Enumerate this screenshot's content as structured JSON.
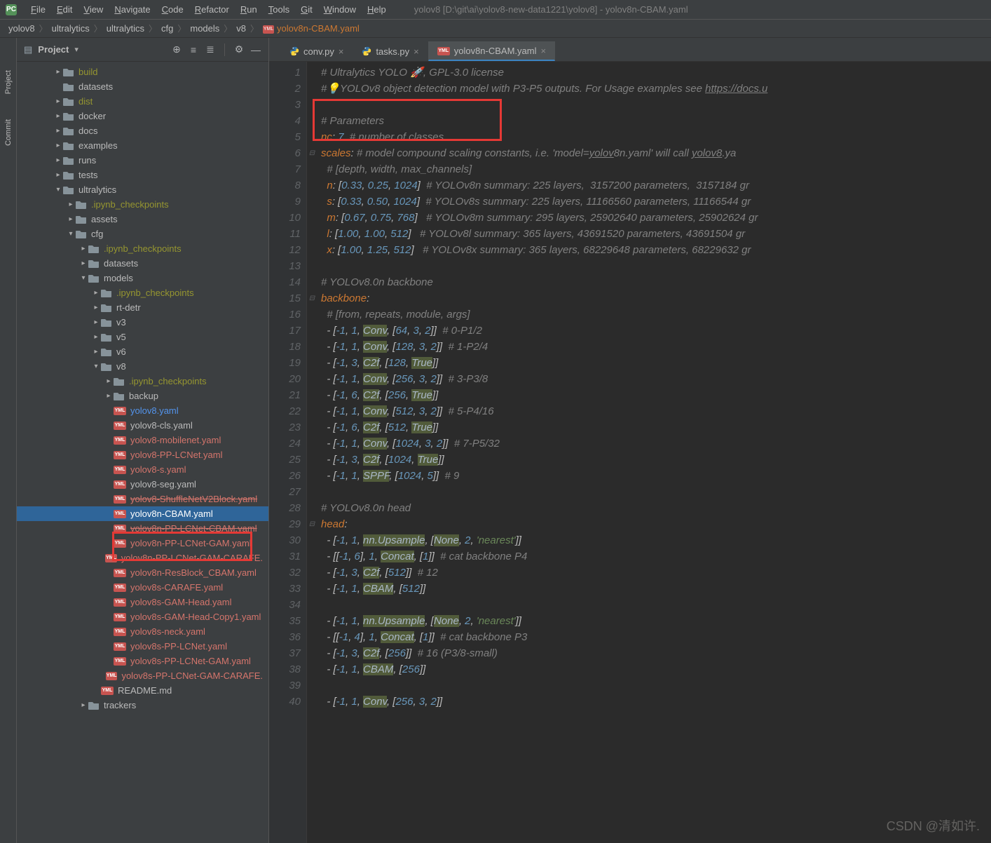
{
  "menubar": {
    "items": [
      "File",
      "Edit",
      "View",
      "Navigate",
      "Code",
      "Refactor",
      "Run",
      "Tools",
      "Git",
      "Window",
      "Help"
    ],
    "title": "yolov8 [D:\\git\\ai\\yolov8-new-data1221\\yolov8] - yolov8n-CBAM.yaml"
  },
  "breadcrumb": [
    "yolov8",
    "ultralytics",
    "ultralytics",
    "cfg",
    "models",
    "v8",
    "yolov8n-CBAM.yaml"
  ],
  "left_gutter": {
    "project_label": "Project",
    "commit_label": "Commit"
  },
  "project_panel": {
    "title": "Project"
  },
  "tree": [
    {
      "d": 2,
      "t": "folder",
      "chev": ">",
      "name": "build",
      "cls": "olive"
    },
    {
      "d": 2,
      "t": "folder",
      "chev": "",
      "name": "datasets",
      "cls": ""
    },
    {
      "d": 2,
      "t": "folder",
      "chev": ">",
      "name": "dist",
      "cls": "olive"
    },
    {
      "d": 2,
      "t": "folder",
      "chev": ">",
      "name": "docker",
      "cls": ""
    },
    {
      "d": 2,
      "t": "folder",
      "chev": ">",
      "name": "docs",
      "cls": ""
    },
    {
      "d": 2,
      "t": "folder",
      "chev": ">",
      "name": "examples",
      "cls": ""
    },
    {
      "d": 2,
      "t": "folder",
      "chev": ">",
      "name": "runs",
      "cls": ""
    },
    {
      "d": 2,
      "t": "folder",
      "chev": ">",
      "name": "tests",
      "cls": ""
    },
    {
      "d": 2,
      "t": "folder",
      "chev": "v",
      "name": "ultralytics",
      "cls": ""
    },
    {
      "d": 3,
      "t": "folder",
      "chev": ">",
      "name": ".ipynb_checkpoints",
      "cls": "olive"
    },
    {
      "d": 3,
      "t": "folder",
      "chev": ">",
      "name": "assets",
      "cls": ""
    },
    {
      "d": 3,
      "t": "folder",
      "chev": "v",
      "name": "cfg",
      "cls": ""
    },
    {
      "d": 4,
      "t": "folder",
      "chev": ">",
      "name": ".ipynb_checkpoints",
      "cls": "olive"
    },
    {
      "d": 4,
      "t": "folder",
      "chev": ">",
      "name": "datasets",
      "cls": ""
    },
    {
      "d": 4,
      "t": "folder",
      "chev": "v",
      "name": "models",
      "cls": ""
    },
    {
      "d": 5,
      "t": "folder",
      "chev": ">",
      "name": ".ipynb_checkpoints",
      "cls": "olive"
    },
    {
      "d": 5,
      "t": "folder",
      "chev": ">",
      "name": "rt-detr",
      "cls": ""
    },
    {
      "d": 5,
      "t": "folder",
      "chev": ">",
      "name": "v3",
      "cls": ""
    },
    {
      "d": 5,
      "t": "folder",
      "chev": ">",
      "name": "v5",
      "cls": ""
    },
    {
      "d": 5,
      "t": "folder",
      "chev": ">",
      "name": "v6",
      "cls": ""
    },
    {
      "d": 5,
      "t": "folder",
      "chev": "v",
      "name": "v8",
      "cls": ""
    },
    {
      "d": 6,
      "t": "folder",
      "chev": ">",
      "name": ".ipynb_checkpoints",
      "cls": "olive"
    },
    {
      "d": 6,
      "t": "folder",
      "chev": ">",
      "name": "backup",
      "cls": ""
    },
    {
      "d": 6,
      "t": "yaml",
      "chev": "",
      "name": "yolov8.yaml",
      "cls": "blue"
    },
    {
      "d": 6,
      "t": "yaml",
      "chev": "",
      "name": "yolov8-cls.yaml",
      "cls": ""
    },
    {
      "d": 6,
      "t": "yaml",
      "chev": "",
      "name": "yolov8-mobilenet.yaml",
      "cls": "red"
    },
    {
      "d": 6,
      "t": "yaml",
      "chev": "",
      "name": "yolov8-PP-LCNet.yaml",
      "cls": "red"
    },
    {
      "d": 6,
      "t": "yaml",
      "chev": "",
      "name": "yolov8-s.yaml",
      "cls": "red"
    },
    {
      "d": 6,
      "t": "yaml",
      "chev": "",
      "name": "yolov8-seg.yaml",
      "cls": ""
    },
    {
      "d": 6,
      "t": "yaml",
      "chev": "",
      "name": "yolov8-ShuffleNetV2Block.yaml",
      "cls": "red struck"
    },
    {
      "d": 6,
      "t": "yaml",
      "chev": "",
      "name": "yolov8n-CBAM.yaml",
      "cls": "red",
      "sel": true
    },
    {
      "d": 6,
      "t": "yaml",
      "chev": "",
      "name": "yolov8n-PP-LCNet-CBAM.yaml",
      "cls": "red struck"
    },
    {
      "d": 6,
      "t": "yaml",
      "chev": "",
      "name": "yolov8n-PP-LCNet-GAM.yaml",
      "cls": "red"
    },
    {
      "d": 6,
      "t": "yaml",
      "chev": "",
      "name": "yolov8n-PP-LCNet-GAM-CARAFE.",
      "cls": "red"
    },
    {
      "d": 6,
      "t": "yaml",
      "chev": "",
      "name": "yolov8n-ResBlock_CBAM.yaml",
      "cls": "red"
    },
    {
      "d": 6,
      "t": "yaml",
      "chev": "",
      "name": "yolov8s-CARAFE.yaml",
      "cls": "red"
    },
    {
      "d": 6,
      "t": "yaml",
      "chev": "",
      "name": "yolov8s-GAM-Head.yaml",
      "cls": "red"
    },
    {
      "d": 6,
      "t": "yaml",
      "chev": "",
      "name": "yolov8s-GAM-Head-Copy1.yaml",
      "cls": "red"
    },
    {
      "d": 6,
      "t": "yaml",
      "chev": "",
      "name": "yolov8s-neck.yaml",
      "cls": "red"
    },
    {
      "d": 6,
      "t": "yaml",
      "chev": "",
      "name": "yolov8s-PP-LCNet.yaml",
      "cls": "red"
    },
    {
      "d": 6,
      "t": "yaml",
      "chev": "",
      "name": "yolov8s-PP-LCNet-GAM.yaml",
      "cls": "red"
    },
    {
      "d": 6,
      "t": "yaml",
      "chev": "",
      "name": "yolov8s-PP-LCNet-GAM-CARAFE.",
      "cls": "red"
    },
    {
      "d": 5,
      "t": "yaml",
      "chev": "",
      "name": "README.md",
      "cls": ""
    },
    {
      "d": 4,
      "t": "folder",
      "chev": ">",
      "name": "trackers",
      "cls": ""
    }
  ],
  "tabs": [
    {
      "name": "conv.py",
      "icon": "py",
      "active": false
    },
    {
      "name": "tasks.py",
      "icon": "py",
      "active": false
    },
    {
      "name": "yolov8n-CBAM.yaml",
      "icon": "yaml",
      "active": true
    }
  ],
  "code_lines": [
    {
      "n": 1,
      "html": "<span class='c-comment'># Ultralytics YOLO 🚀, GPL-3.0 license</span>"
    },
    {
      "n": 2,
      "html": "<span class='c-comment'>#💡YOLOv8 object detection model with P3-P5 outputs. For Usage examples see <u>https://docs.u</u></span>"
    },
    {
      "n": 3,
      "html": ""
    },
    {
      "n": 4,
      "html": "<span class='c-comment'># Parameters</span>"
    },
    {
      "n": 5,
      "html": "<span class='c-key'>nc</span>: <span class='c-num'>7</span>  <span class='c-comment'># number of classes</span>"
    },
    {
      "n": 6,
      "html": "<span class='c-key'>scales</span>: <span class='c-comment'># model compound scaling constants, i.e. 'model=<u>yolov</u>8n.yaml' will call <u>yolov8</u>.ya</span>"
    },
    {
      "n": 7,
      "html": "  <span class='c-comment'># [depth, width, max_channels]</span>"
    },
    {
      "n": 8,
      "html": "  <span class='c-key'>n</span>: [<span class='c-num'>0.33</span>, <span class='c-num'>0.25</span>, <span class='c-num'>1024</span>]  <span class='c-comment'># YOLOv8n summary: 225 layers,  3157200 parameters,  3157184 gr</span>"
    },
    {
      "n": 9,
      "html": "  <span class='c-key'>s</span>: [<span class='c-num'>0.33</span>, <span class='c-num'>0.50</span>, <span class='c-num'>1024</span>]  <span class='c-comment'># YOLOv8s summary: 225 layers, 11166560 parameters, 11166544 gr</span>"
    },
    {
      "n": 10,
      "html": "  <span class='c-key'>m</span>: [<span class='c-num'>0.67</span>, <span class='c-num'>0.75</span>, <span class='c-num'>768</span>]   <span class='c-comment'># YOLOv8m summary: 295 layers, 25902640 parameters, 25902624 gr</span>"
    },
    {
      "n": 11,
      "html": "  <span class='c-key'>l</span>: [<span class='c-num'>1.00</span>, <span class='c-num'>1.00</span>, <span class='c-num'>512</span>]   <span class='c-comment'># YOLOv8l summary: 365 layers, 43691520 parameters, 43691504 gr</span>"
    },
    {
      "n": 12,
      "html": "  <span class='c-key'>x</span>: [<span class='c-num'>1.00</span>, <span class='c-num'>1.25</span>, <span class='c-num'>512</span>]   <span class='c-comment'># YOLOv8x summary: 365 layers, 68229648 parameters, 68229632 gr</span>"
    },
    {
      "n": 13,
      "html": ""
    },
    {
      "n": 14,
      "html": "<span class='c-comment'># YOLOv8.0n backbone</span>"
    },
    {
      "n": 15,
      "html": "<span class='c-key'>backbone</span>:"
    },
    {
      "n": 16,
      "html": "  <span class='c-comment'># [from, repeats, module, args]</span>"
    },
    {
      "n": 17,
      "html": "  - [<span class='c-num'>-1</span>, <span class='c-num'>1</span>, <span class='c-bg'>Conv</span>, [<span class='c-num'>64</span>, <span class='c-num'>3</span>, <span class='c-num'>2</span>]]  <span class='c-comment'># 0-P1/2</span>"
    },
    {
      "n": 18,
      "html": "  - [<span class='c-num'>-1</span>, <span class='c-num'>1</span>, <span class='c-bg'>Conv</span>, [<span class='c-num'>128</span>, <span class='c-num'>3</span>, <span class='c-num'>2</span>]]  <span class='c-comment'># 1-P2/4</span>"
    },
    {
      "n": 19,
      "html": "  - [<span class='c-num'>-1</span>, <span class='c-num'>3</span>, <span class='c-bg'>C2f</span>, [<span class='c-num'>128</span>, <span class='c-bg'>True</span>]]"
    },
    {
      "n": 20,
      "html": "  - [<span class='c-num'>-1</span>, <span class='c-num'>1</span>, <span class='c-bg'>Conv</span>, [<span class='c-num'>256</span>, <span class='c-num'>3</span>, <span class='c-num'>2</span>]]  <span class='c-comment'># 3-P3/8</span>"
    },
    {
      "n": 21,
      "html": "  - [<span class='c-num'>-1</span>, <span class='c-num'>6</span>, <span class='c-bg'>C2f</span>, [<span class='c-num'>256</span>, <span class='c-bg'>True</span>]]"
    },
    {
      "n": 22,
      "html": "  - [<span class='c-num'>-1</span>, <span class='c-num'>1</span>, <span class='c-bg'>Conv</span>, [<span class='c-num'>512</span>, <span class='c-num'>3</span>, <span class='c-num'>2</span>]]  <span class='c-comment'># 5-P4/16</span>"
    },
    {
      "n": 23,
      "html": "  - [<span class='c-num'>-1</span>, <span class='c-num'>6</span>, <span class='c-bg'>C2f</span>, [<span class='c-num'>512</span>, <span class='c-bg'>True</span>]]"
    },
    {
      "n": 24,
      "html": "  - [<span class='c-num'>-1</span>, <span class='c-num'>1</span>, <span class='c-bg'>Conv</span>, [<span class='c-num'>1024</span>, <span class='c-num'>3</span>, <span class='c-num'>2</span>]]  <span class='c-comment'># 7-P5/32</span>"
    },
    {
      "n": 25,
      "html": "  - [<span class='c-num'>-1</span>, <span class='c-num'>3</span>, <span class='c-bg'>C2f</span>, [<span class='c-num'>1024</span>, <span class='c-bg'>True</span>]]"
    },
    {
      "n": 26,
      "html": "  - [<span class='c-num'>-1</span>, <span class='c-num'>1</span>, <span class='c-bg'>SPPF</span>, [<span class='c-num'>1024</span>, <span class='c-num'>5</span>]]  <span class='c-comment'># 9</span>"
    },
    {
      "n": 27,
      "html": ""
    },
    {
      "n": 28,
      "html": "<span class='c-comment'># YOLOv8.0n head</span>"
    },
    {
      "n": 29,
      "html": "<span class='c-key'>head</span>:"
    },
    {
      "n": 30,
      "html": "  - [<span class='c-num'>-1</span>, <span class='c-num'>1</span>, <span class='c-bg'>nn.Upsample</span>, [<span class='c-bg'>None</span>, <span class='c-num'>2</span>, <span class='c-str'>'nearest'</span>]]"
    },
    {
      "n": 31,
      "html": "  - [[<span class='c-num'>-1</span>, <span class='c-num'>6</span>], <span class='c-num'>1</span>, <span class='c-bg'>Concat</span>, [<span class='c-num'>1</span>]]  <span class='c-comment'># cat backbone P4</span>"
    },
    {
      "n": 32,
      "html": "  - [<span class='c-num'>-1</span>, <span class='c-num'>3</span>, <span class='c-bg'>C2f</span>, [<span class='c-num'>512</span>]]  <span class='c-comment'># 12</span>"
    },
    {
      "n": 33,
      "html": "  - [<span class='c-num'>-1</span>, <span class='c-num'>1</span>, <span class='c-bg'>CBAM</span>, [<span class='c-num'>512</span>]]"
    },
    {
      "n": 34,
      "html": ""
    },
    {
      "n": 35,
      "html": "  - [<span class='c-num'>-1</span>, <span class='c-num'>1</span>, <span class='c-bg'>nn.Upsample</span>, [<span class='c-bg'>None</span>, <span class='c-num'>2</span>, <span class='c-str'>'nearest'</span>]]"
    },
    {
      "n": 36,
      "html": "  - [[<span class='c-num'>-1</span>, <span class='c-num'>4</span>], <span class='c-num'>1</span>, <span class='c-bg'>Concat</span>, [<span class='c-num'>1</span>]]  <span class='c-comment'># cat backbone P3</span>"
    },
    {
      "n": 37,
      "html": "  - [<span class='c-num'>-1</span>, <span class='c-num'>3</span>, <span class='c-bg'>C2f</span>, [<span class='c-num'>256</span>]]  <span class='c-comment'># 16 (P3/8-small)</span>"
    },
    {
      "n": 38,
      "html": "  - [<span class='c-num'>-1</span>, <span class='c-num'>1</span>, <span class='c-bg'>CBAM</span>, [<span class='c-num'>256</span>]]"
    },
    {
      "n": 39,
      "html": ""
    },
    {
      "n": 40,
      "html": "  - [<span class='c-num'>-1</span>, <span class='c-num'>1</span>, <span class='c-bg'>Conv</span>, [<span class='c-num'>256</span>, <span class='c-num'>3</span>, <span class='c-num'>2</span>]]"
    }
  ],
  "watermark": "CSDN @清如许."
}
